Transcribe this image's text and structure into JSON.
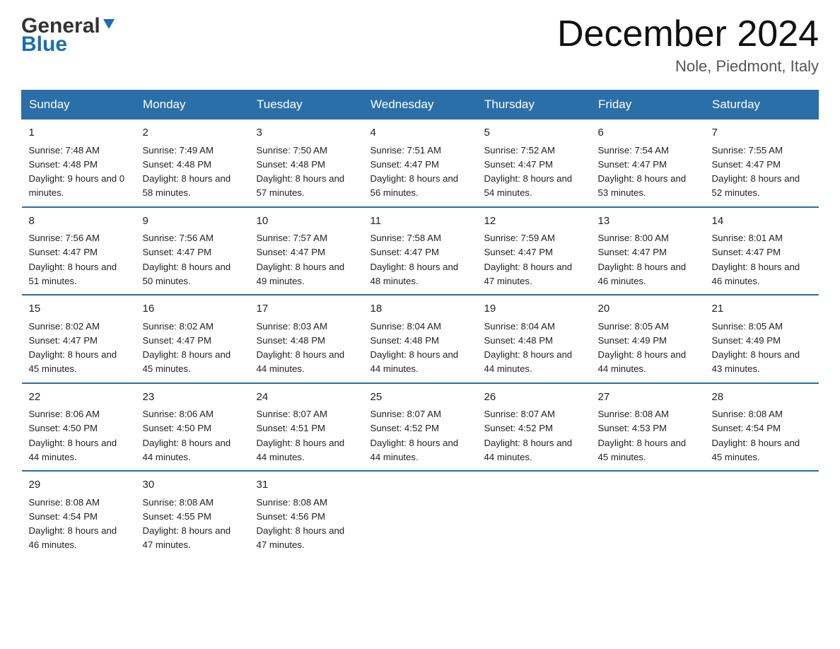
{
  "logo": {
    "general": "General",
    "blue": "Blue"
  },
  "title": "December 2024",
  "location": "Nole, Piedmont, Italy",
  "days_of_week": [
    "Sunday",
    "Monday",
    "Tuesday",
    "Wednesday",
    "Thursday",
    "Friday",
    "Saturday"
  ],
  "weeks": [
    [
      {
        "num": "1",
        "sunrise": "7:48 AM",
        "sunset": "4:48 PM",
        "daylight": "9 hours and 0 minutes."
      },
      {
        "num": "2",
        "sunrise": "7:49 AM",
        "sunset": "4:48 PM",
        "daylight": "8 hours and 58 minutes."
      },
      {
        "num": "3",
        "sunrise": "7:50 AM",
        "sunset": "4:48 PM",
        "daylight": "8 hours and 57 minutes."
      },
      {
        "num": "4",
        "sunrise": "7:51 AM",
        "sunset": "4:47 PM",
        "daylight": "8 hours and 56 minutes."
      },
      {
        "num": "5",
        "sunrise": "7:52 AM",
        "sunset": "4:47 PM",
        "daylight": "8 hours and 54 minutes."
      },
      {
        "num": "6",
        "sunrise": "7:54 AM",
        "sunset": "4:47 PM",
        "daylight": "8 hours and 53 minutes."
      },
      {
        "num": "7",
        "sunrise": "7:55 AM",
        "sunset": "4:47 PM",
        "daylight": "8 hours and 52 minutes."
      }
    ],
    [
      {
        "num": "8",
        "sunrise": "7:56 AM",
        "sunset": "4:47 PM",
        "daylight": "8 hours and 51 minutes."
      },
      {
        "num": "9",
        "sunrise": "7:56 AM",
        "sunset": "4:47 PM",
        "daylight": "8 hours and 50 minutes."
      },
      {
        "num": "10",
        "sunrise": "7:57 AM",
        "sunset": "4:47 PM",
        "daylight": "8 hours and 49 minutes."
      },
      {
        "num": "11",
        "sunrise": "7:58 AM",
        "sunset": "4:47 PM",
        "daylight": "8 hours and 48 minutes."
      },
      {
        "num": "12",
        "sunrise": "7:59 AM",
        "sunset": "4:47 PM",
        "daylight": "8 hours and 47 minutes."
      },
      {
        "num": "13",
        "sunrise": "8:00 AM",
        "sunset": "4:47 PM",
        "daylight": "8 hours and 46 minutes."
      },
      {
        "num": "14",
        "sunrise": "8:01 AM",
        "sunset": "4:47 PM",
        "daylight": "8 hours and 46 minutes."
      }
    ],
    [
      {
        "num": "15",
        "sunrise": "8:02 AM",
        "sunset": "4:47 PM",
        "daylight": "8 hours and 45 minutes."
      },
      {
        "num": "16",
        "sunrise": "8:02 AM",
        "sunset": "4:47 PM",
        "daylight": "8 hours and 45 minutes."
      },
      {
        "num": "17",
        "sunrise": "8:03 AM",
        "sunset": "4:48 PM",
        "daylight": "8 hours and 44 minutes."
      },
      {
        "num": "18",
        "sunrise": "8:04 AM",
        "sunset": "4:48 PM",
        "daylight": "8 hours and 44 minutes."
      },
      {
        "num": "19",
        "sunrise": "8:04 AM",
        "sunset": "4:48 PM",
        "daylight": "8 hours and 44 minutes."
      },
      {
        "num": "20",
        "sunrise": "8:05 AM",
        "sunset": "4:49 PM",
        "daylight": "8 hours and 44 minutes."
      },
      {
        "num": "21",
        "sunrise": "8:05 AM",
        "sunset": "4:49 PM",
        "daylight": "8 hours and 43 minutes."
      }
    ],
    [
      {
        "num": "22",
        "sunrise": "8:06 AM",
        "sunset": "4:50 PM",
        "daylight": "8 hours and 44 minutes."
      },
      {
        "num": "23",
        "sunrise": "8:06 AM",
        "sunset": "4:50 PM",
        "daylight": "8 hours and 44 minutes."
      },
      {
        "num": "24",
        "sunrise": "8:07 AM",
        "sunset": "4:51 PM",
        "daylight": "8 hours and 44 minutes."
      },
      {
        "num": "25",
        "sunrise": "8:07 AM",
        "sunset": "4:52 PM",
        "daylight": "8 hours and 44 minutes."
      },
      {
        "num": "26",
        "sunrise": "8:07 AM",
        "sunset": "4:52 PM",
        "daylight": "8 hours and 44 minutes."
      },
      {
        "num": "27",
        "sunrise": "8:08 AM",
        "sunset": "4:53 PM",
        "daylight": "8 hours and 45 minutes."
      },
      {
        "num": "28",
        "sunrise": "8:08 AM",
        "sunset": "4:54 PM",
        "daylight": "8 hours and 45 minutes."
      }
    ],
    [
      {
        "num": "29",
        "sunrise": "8:08 AM",
        "sunset": "4:54 PM",
        "daylight": "8 hours and 46 minutes."
      },
      {
        "num": "30",
        "sunrise": "8:08 AM",
        "sunset": "4:55 PM",
        "daylight": "8 hours and 47 minutes."
      },
      {
        "num": "31",
        "sunrise": "8:08 AM",
        "sunset": "4:56 PM",
        "daylight": "8 hours and 47 minutes."
      },
      {
        "num": "",
        "sunrise": "",
        "sunset": "",
        "daylight": ""
      },
      {
        "num": "",
        "sunrise": "",
        "sunset": "",
        "daylight": ""
      },
      {
        "num": "",
        "sunrise": "",
        "sunset": "",
        "daylight": ""
      },
      {
        "num": "",
        "sunrise": "",
        "sunset": "",
        "daylight": ""
      }
    ]
  ]
}
